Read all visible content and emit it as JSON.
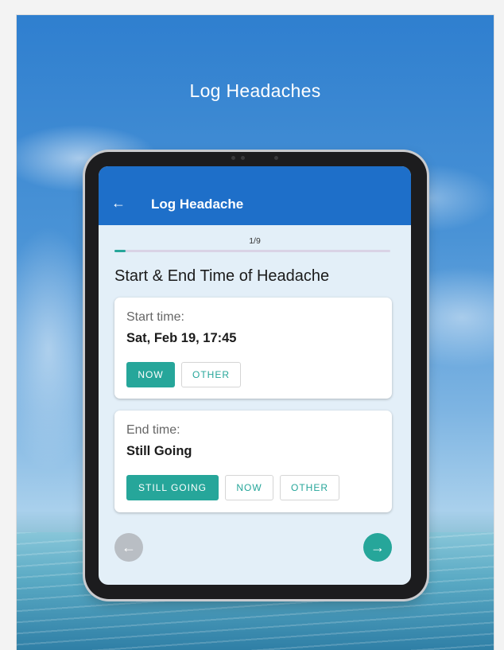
{
  "hero": {
    "title": "Log Headaches"
  },
  "appbar": {
    "back_icon": "←",
    "title": "Log Headache"
  },
  "progress": {
    "label": "1/9",
    "value": 0.04
  },
  "section": {
    "title": "Start & End Time of Headache"
  },
  "start_card": {
    "label": "Start time:",
    "value": "Sat, Feb 19, 17:45",
    "buttons": {
      "now": "NOW",
      "other": "OTHER"
    }
  },
  "end_card": {
    "label": "End time:",
    "value": "Still Going",
    "buttons": {
      "still_going": "STILL GOING",
      "now": "NOW",
      "other": "OTHER"
    }
  },
  "nav": {
    "prev_icon": "←",
    "next_icon": "→"
  },
  "colors": {
    "appbar": "#1e6fc9",
    "accent": "#26a69a",
    "screen_bg": "#e3eff8",
    "disabled": "#b9bec4"
  }
}
